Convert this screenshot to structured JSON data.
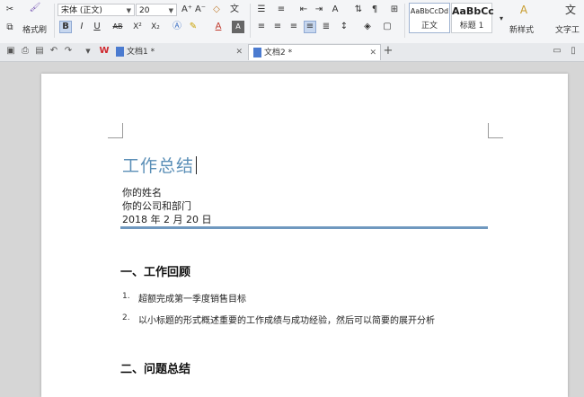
{
  "ribbon": {
    "format_painter": "格式刷",
    "font_name": "宋体 (正文)",
    "font_size": "20",
    "grow_font": "A⁺",
    "shrink_font": "A⁻",
    "bold": "B",
    "italic": "I",
    "underline": "U",
    "strike": "AB",
    "superscript": "X²",
    "subscript": "X₂",
    "styles": [
      {
        "sample": "AaBbCcDd",
        "name": "正文"
      },
      {
        "sample": "AaBbCc",
        "name": "标题 1"
      }
    ],
    "new_style": "新样式",
    "text_tools": "文字工"
  },
  "tabs": [
    {
      "label": "文档1 *",
      "active": false
    },
    {
      "label": "文档2 *",
      "active": true
    }
  ],
  "document": {
    "title": "工作总结",
    "name_line": "你的姓名",
    "company_line": "你的公司和部门",
    "date_line": "2018 年 2 月 20 日",
    "section1_heading": "一、工作回顾",
    "section1_items": [
      {
        "num": "1.",
        "text": "超额完成第一季度销售目标"
      },
      {
        "num": "2.",
        "text": "以小标题的形式概述重要的工作成绩与成功经验，然后可以简要的展开分析"
      }
    ],
    "section2_heading": "二、问题总结"
  },
  "colors": {
    "title": "#5b8fb7",
    "rule": "#6f98bf",
    "ribbon_bg": "#f4f5f7",
    "workspace_bg": "#d6d6d6"
  }
}
